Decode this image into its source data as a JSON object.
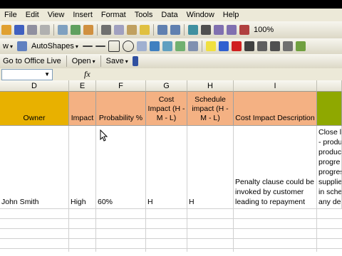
{
  "menu": [
    "File",
    "Edit",
    "View",
    "Insert",
    "Format",
    "Tools",
    "Data",
    "Window",
    "Help"
  ],
  "toolbar1": {
    "zoom": "100%"
  },
  "toolbar2": {
    "autoshapes_label": "AutoShapes"
  },
  "toolbar3": {
    "office_live_label": "Go to Office Live",
    "open_label": "Open",
    "save_label": "Save"
  },
  "formula_bar": {
    "name_box": "",
    "fx_label": "fx"
  },
  "columns": [
    "D",
    "E",
    "F",
    "G",
    "H",
    "I"
  ],
  "headers": {
    "owner": "Owner",
    "impact": "Impact",
    "probability": "Probability %",
    "cost_impact": "Cost Impact (H - M - L)",
    "schedule_impact": "Schedule impact (H - M - L)",
    "cost_impact_desc": "Cost Impact Description"
  },
  "row": {
    "owner": "John Smith",
    "impact": "High",
    "probability": "60%",
    "cost_impact": "H",
    "schedule_impact": "H",
    "cost_impact_desc": "Penalty clause could be invoked by customer leading to repayment",
    "partial_col": "Close l - produ produc progre progres supplie in sche any de"
  },
  "colors": {
    "gold": "#e8b100",
    "salmon": "#f4b183",
    "olive": "#8fa800"
  }
}
